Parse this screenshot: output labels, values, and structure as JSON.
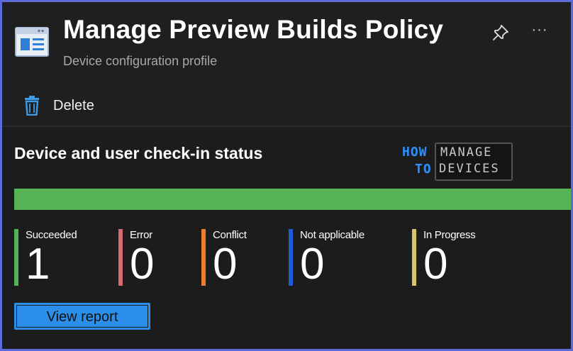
{
  "header": {
    "title": "Manage Preview Builds Policy",
    "subtitle": "Device configuration profile",
    "icons": [
      "device-config-icon",
      "pin-icon",
      "more-icon"
    ],
    "more_glyph": "···"
  },
  "toolbar": {
    "delete_label": "Delete",
    "delete_icon": "trash-icon"
  },
  "status_section": {
    "title": "Device and user check-in status",
    "watermark": {
      "how": "HOW",
      "to": "TO",
      "manage": "MANAGE",
      "devices": "DEVICES"
    },
    "progress": {
      "succeeded_fraction": 1.0,
      "fill_color": "#54b354"
    },
    "stats": [
      {
        "label": "Succeeded",
        "value": "1",
        "color": "#54b354"
      },
      {
        "label": "Error",
        "value": "0",
        "color": "#d76a73"
      },
      {
        "label": "Conflict",
        "value": "0",
        "color": "#f07d2e"
      },
      {
        "label": "Not applicable",
        "value": "0",
        "color": "#1f5bd8"
      },
      {
        "label": "In Progress",
        "value": "0",
        "color": "#d8c46a"
      }
    ],
    "view_report_label": "View report"
  },
  "colors": {
    "accent": "#2b8ee8",
    "frame_border": "#5b6ad8",
    "background": "#1f1f1f"
  }
}
